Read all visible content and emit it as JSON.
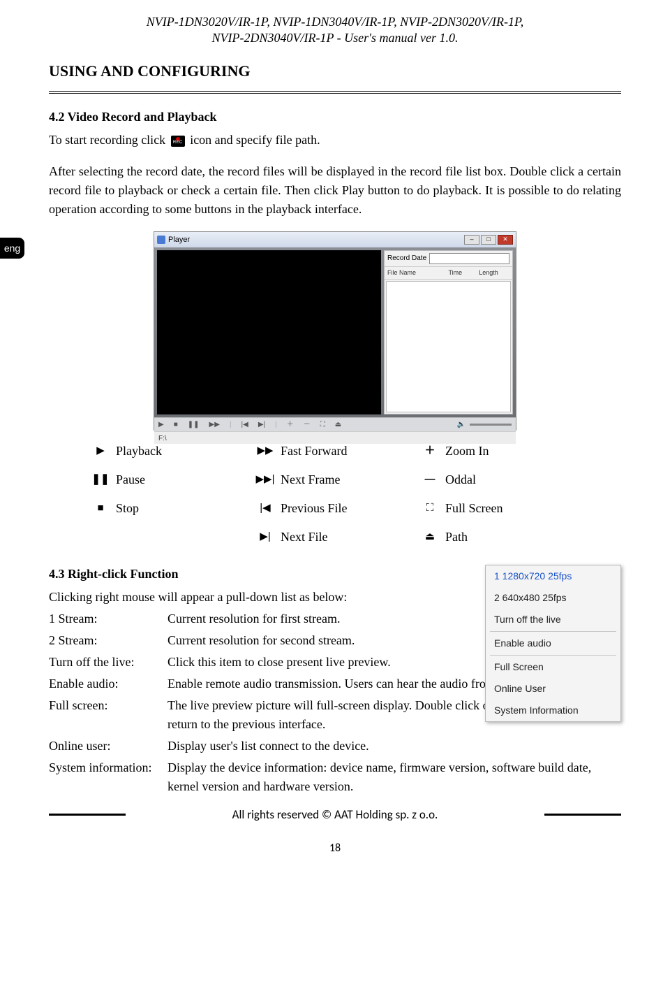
{
  "header": {
    "line1": "NVIP-1DN3020V/IR-1P, NVIP-1DN3040V/IR-1P, NVIP-2DN3020V/IR-1P,",
    "line2": "NVIP-2DN3040V/IR-1P - User's manual ver 1.0."
  },
  "langTab": "eng",
  "sectionTitle": "USING AND CONFIGURING",
  "s42": {
    "heading": "4.2 Video Record and Playback",
    "p1a": "To start recording click ",
    "p1b": " icon and specify file path.",
    "p2": "After selecting the record date, the record files will be displayed in the record file list box. Double click a certain record file to playback or check a certain file. Then click Play button to do playback. It is possible to do relating operation according to some buttons in the playback interface."
  },
  "player": {
    "title": "Player",
    "recordDateLabel": "Record Date",
    "col1": "File Name",
    "col2": "Time",
    "col3": "Length",
    "pathValue": "F:\\",
    "volIcon": "🔈"
  },
  "legend": {
    "playback": "Playback",
    "pause": "Pause",
    "stop": "Stop",
    "fastForward": "Fast Forward",
    "nextFrame": "Next Frame",
    "previousFile": "Previous File",
    "nextFile": "Next File",
    "zoomIn": "Zoom In",
    "oddal": "Oddal",
    "fullScreen": "Full Screen",
    "path": "Path"
  },
  "s43": {
    "heading": "4.3 Right-click Function",
    "intro": "Clicking right mouse will appear a pull-down list as below:",
    "items": [
      {
        "term": "1 Stream:",
        "desc": "Current resolution for first stream."
      },
      {
        "term": "2 Stream:",
        "desc": "Current resolution for second stream."
      },
      {
        "term": "Turn off the live:",
        "desc": "Click this item to close present live preview."
      },
      {
        "term": "Enable audio:",
        "desc": "Enable remote audio transmission. Users can hear the audio from the IP Camera."
      },
      {
        "term": "Full screen:",
        "desc": "The live preview picture will full-screen display. Double click or click right mouse to return to the previous interface."
      },
      {
        "term": "Online user:",
        "desc": "Display user's list connect to the device."
      },
      {
        "term": "System information:",
        "desc": "Display the device information: device name, firmware version, software build date, kernel version and hardware version."
      }
    ]
  },
  "contextMenu": {
    "items": [
      "1 1280x720 25fps",
      "2 640x480 25fps",
      "Turn off the live",
      "Enable audio",
      "Full Screen",
      "Online User",
      "System Information"
    ]
  },
  "footer": {
    "copyright": "All rights reserved © AAT Holding sp. z o.o.",
    "pageNum": "18"
  }
}
